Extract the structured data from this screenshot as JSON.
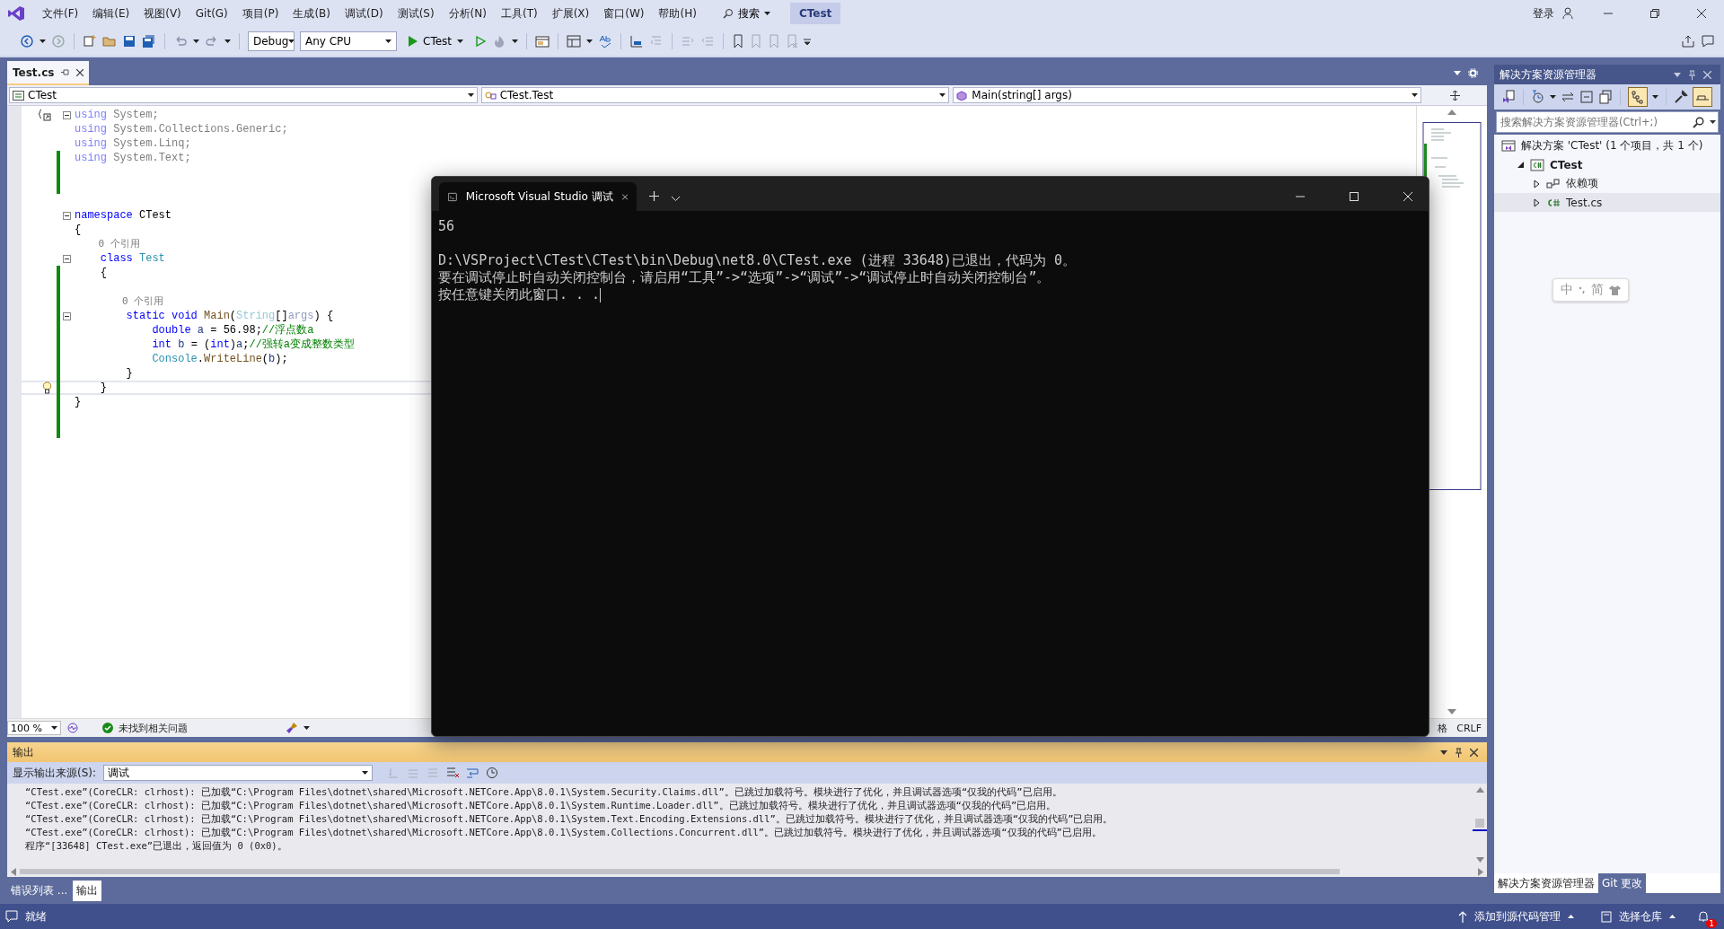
{
  "menu": [
    "文件(F)",
    "编辑(E)",
    "视图(V)",
    "Git(G)",
    "项目(P)",
    "生成(B)",
    "调试(D)",
    "测试(S)",
    "分析(N)",
    "工具(T)",
    "扩展(X)",
    "窗口(W)",
    "帮助(H)"
  ],
  "search": {
    "label": "搜索"
  },
  "solution_name": "CTest",
  "account": {
    "label": "登录"
  },
  "toolbar": {
    "configuration": "Debug",
    "platform": "Any CPU",
    "start_target": "CTest"
  },
  "editor": {
    "tabs": [
      {
        "label": "Test.cs",
        "selected": true
      }
    ],
    "nav": [
      "CTest",
      "CTest.Test",
      "Main(string[] args)"
    ],
    "lines": [
      {
        "kind": "code",
        "changed": false,
        "collapsible": true,
        "current": false,
        "tokens": [
          {
            "text": "using",
            "kind": "keyword_unused"
          },
          {
            "text": " System;",
            "kind": "unused"
          }
        ]
      },
      {
        "kind": "code",
        "changed": false,
        "collapsible": false,
        "current": false,
        "tokens": [
          {
            "text": "using",
            "kind": "keyword_unused"
          },
          {
            "text": " System.Collections.Generic;",
            "kind": "unused"
          }
        ]
      },
      {
        "kind": "code",
        "changed": false,
        "collapsible": false,
        "current": false,
        "tokens": [
          {
            "text": "using",
            "kind": "keyword_unused"
          },
          {
            "text": " System.Linq;",
            "kind": "unused"
          }
        ]
      },
      {
        "kind": "code",
        "changed": true,
        "collapsible": false,
        "current": false,
        "tokens": [
          {
            "text": "using",
            "kind": "keyword_unused"
          },
          {
            "text": " System.Text;",
            "kind": "unused"
          }
        ]
      },
      {
        "kind": "blank",
        "changed": true,
        "collapsible": false,
        "current": false
      },
      {
        "kind": "blank",
        "changed": true,
        "collapsible": false,
        "current": false
      },
      {
        "kind": "blank",
        "changed": false,
        "collapsible": false,
        "current": false
      },
      {
        "kind": "code",
        "changed": false,
        "collapsible": true,
        "current": false,
        "tokens": [
          {
            "text": "namespace",
            "kind": "keyword"
          },
          {
            "text": " CTest",
            "kind": "plain"
          }
        ]
      },
      {
        "kind": "code",
        "changed": false,
        "collapsible": false,
        "current": false,
        "tokens": [
          {
            "text": "{",
            "kind": "plain"
          }
        ]
      },
      {
        "kind": "codelens",
        "changed": false,
        "collapsible": false,
        "current": false,
        "tokens": [
          {
            "text": "    0 个引用",
            "kind": "reference"
          }
        ]
      },
      {
        "kind": "code",
        "changed": false,
        "collapsible": true,
        "current": false,
        "tokens": [
          {
            "text": "    class",
            "kind": "keyword"
          },
          {
            "text": " Test",
            "kind": "type"
          }
        ]
      },
      {
        "kind": "code",
        "changed": true,
        "collapsible": false,
        "current": false,
        "tokens": [
          {
            "text": "    {",
            "kind": "plain"
          }
        ]
      },
      {
        "kind": "blank",
        "changed": true,
        "collapsible": false,
        "current": false
      },
      {
        "kind": "codelens",
        "changed": true,
        "collapsible": false,
        "current": false,
        "tokens": [
          {
            "text": "        0 个引用",
            "kind": "reference"
          }
        ]
      },
      {
        "kind": "code",
        "changed": true,
        "collapsible": true,
        "current": false,
        "tokens": [
          {
            "text": "        static void ",
            "kind": "keyword"
          },
          {
            "text": "Main",
            "kind": "method"
          },
          {
            "text": "(",
            "kind": "plain"
          },
          {
            "text": "String",
            "kind": "type_unused"
          },
          {
            "text": "[]",
            "kind": "plain"
          },
          {
            "text": "args",
            "kind": "variable_unused"
          },
          {
            "text": ") {",
            "kind": "plain"
          }
        ]
      },
      {
        "kind": "code",
        "changed": true,
        "collapsible": false,
        "current": false,
        "tokens": [
          {
            "text": "            double",
            "kind": "keyword"
          },
          {
            "text": " a",
            "kind": "variable"
          },
          {
            "text": " = 56.98;",
            "kind": "plain"
          },
          {
            "text": "//浮点数a",
            "kind": "comment"
          }
        ]
      },
      {
        "kind": "code",
        "changed": true,
        "collapsible": false,
        "current": false,
        "tokens": [
          {
            "text": "            int",
            "kind": "keyword"
          },
          {
            "text": " b",
            "kind": "variable"
          },
          {
            "text": " = (",
            "kind": "plain"
          },
          {
            "text": "int",
            "kind": "keyword"
          },
          {
            "text": ")",
            "kind": "plain"
          },
          {
            "text": "a",
            "kind": "variable"
          },
          {
            "text": ";",
            "kind": "plain"
          },
          {
            "text": "//强转a变成整数类型",
            "kind": "comment"
          }
        ]
      },
      {
        "kind": "code",
        "changed": true,
        "collapsible": false,
        "current": false,
        "tokens": [
          {
            "text": "            Console",
            "kind": "type"
          },
          {
            "text": ".",
            "kind": "plain"
          },
          {
            "text": "WriteLine",
            "kind": "method"
          },
          {
            "text": "(",
            "kind": "plain"
          },
          {
            "text": "b",
            "kind": "variable"
          },
          {
            "text": ");",
            "kind": "plain"
          }
        ]
      },
      {
        "kind": "code",
        "changed": true,
        "collapsible": false,
        "current": false,
        "tokens": [
          {
            "text": "        }",
            "kind": "plain"
          }
        ]
      },
      {
        "kind": "code",
        "changed": true,
        "collapsible": false,
        "current": true,
        "tokens": [
          {
            "text": "    }",
            "kind": "plain"
          }
        ]
      },
      {
        "kind": "code",
        "changed": true,
        "collapsible": false,
        "current": false,
        "tokens": [
          {
            "text": "}",
            "kind": "plain"
          }
        ]
      },
      {
        "kind": "blank",
        "changed": true,
        "collapsible": false,
        "current": false
      },
      {
        "kind": "blank",
        "changed": true,
        "collapsible": false,
        "current": false
      }
    ],
    "zoom": "100 %",
    "issues": "未找到相关问题",
    "status_right": [
      "格",
      "CRLF"
    ]
  },
  "console": {
    "tab": "Microsoft Visual Studio 调试",
    "output": [
      "56"
    ],
    "messages": [
      "D:\\VSProject\\CTest\\CTest\\bin\\Debug\\net8.0\\CTest.exe (进程 33648)已退出，代码为 0。",
      "要在调试停止时自动关闭控制台，请启用“工具”->“选项”->“调试”->“调试停止时自动关闭控制台”。",
      "按任意键关闭此窗口. . ."
    ]
  },
  "output_panel": {
    "title": "输出",
    "source_label": "显示输出来源(S):",
    "source": "调试",
    "lines": [
      "“CTest.exe”(CoreCLR: clrhost): 已加载“C:\\Program Files\\dotnet\\shared\\Microsoft.NETCore.App\\8.0.1\\System.Security.Claims.dll”。已跳过加载符号。模块进行了优化，并且调试器选项“仅我的代码”已启用。",
      "“CTest.exe”(CoreCLR: clrhost): 已加载“C:\\Program Files\\dotnet\\shared\\Microsoft.NETCore.App\\8.0.1\\System.Runtime.Loader.dll”。已跳过加载符号。模块进行了优化，并且调试器选项“仅我的代码”已启用。",
      "“CTest.exe”(CoreCLR: clrhost): 已加载“C:\\Program Files\\dotnet\\shared\\Microsoft.NETCore.App\\8.0.1\\System.Text.Encoding.Extensions.dll”。已跳过加载符号。模块进行了优化，并且调试器选项“仅我的代码”已启用。",
      "“CTest.exe”(CoreCLR: clrhost): 已加载“C:\\Program Files\\dotnet\\shared\\Microsoft.NETCore.App\\8.0.1\\System.Collections.Concurrent.dll”。已跳过加载符号。模块进行了优化，并且调试器选项“仅我的代码”已启用。",
      "程序“[33648] CTest.exe”已退出，返回值为 0 (0x0)。"
    ]
  },
  "bottom_tabs": [
    {
      "label": "错误列表 ...",
      "selected": false
    },
    {
      "label": "输出",
      "selected": true
    }
  ],
  "solution_explorer": {
    "title": "解决方案资源管理器",
    "search": {
      "placeholder": "搜索解决方案资源管理器(Ctrl+;)"
    },
    "tree": [
      {
        "label": "解决方案 'CTest' (1 个项目，共 1 个)",
        "kind": "solution",
        "selected": false,
        "children": [
          {
            "label": "CTest",
            "kind": "project",
            "expanded": true,
            "selected": false,
            "children": [
              {
                "label": "依赖项",
                "kind": "dependencies",
                "expanded": false,
                "selected": false
              },
              {
                "label": "Test.cs",
                "kind": "csfile",
                "expanded": false,
                "selected": true
              }
            ]
          }
        ]
      }
    ]
  },
  "side_tabs": [
    {
      "label": "解决方案资源管理器",
      "selected": true
    },
    {
      "label": "Git 更改",
      "selected": false
    }
  ],
  "ime": {
    "mode": "中",
    "script": "简"
  },
  "status_bar": {
    "state": "就绪",
    "source_control": "添加到源代码管理",
    "repository": "选择仓库",
    "notifications": "1"
  }
}
